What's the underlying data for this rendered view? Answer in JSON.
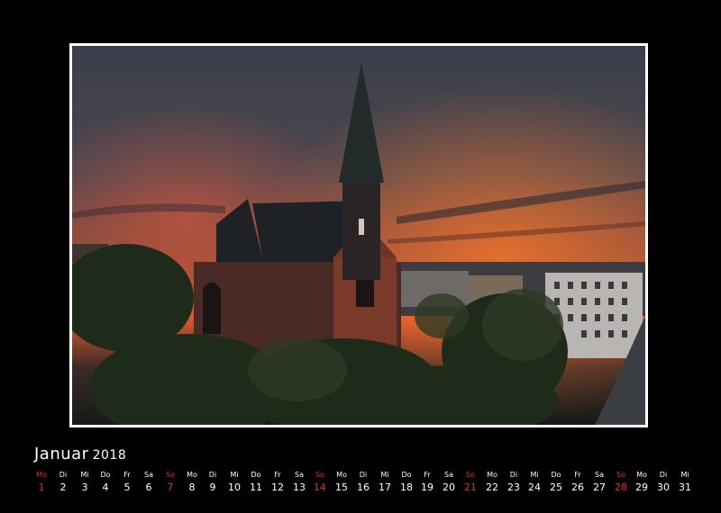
{
  "calendar": {
    "month": "Januar",
    "year": "2018",
    "sunday_color": "#e0302a",
    "days": [
      {
        "name": "Mo",
        "num": "1",
        "sunday": true
      },
      {
        "name": "Di",
        "num": "2",
        "sunday": false
      },
      {
        "name": "Mi",
        "num": "3",
        "sunday": false
      },
      {
        "name": "Do",
        "num": "4",
        "sunday": false
      },
      {
        "name": "Fr",
        "num": "5",
        "sunday": false
      },
      {
        "name": "Sa",
        "num": "6",
        "sunday": false
      },
      {
        "name": "So",
        "num": "7",
        "sunday": true
      },
      {
        "name": "Mo",
        "num": "8",
        "sunday": false
      },
      {
        "name": "Di",
        "num": "9",
        "sunday": false
      },
      {
        "name": "Mi",
        "num": "10",
        "sunday": false
      },
      {
        "name": "Do",
        "num": "11",
        "sunday": false
      },
      {
        "name": "Fr",
        "num": "12",
        "sunday": false
      },
      {
        "name": "Sa",
        "num": "13",
        "sunday": false
      },
      {
        "name": "So",
        "num": "14",
        "sunday": true
      },
      {
        "name": "Mo",
        "num": "15",
        "sunday": false
      },
      {
        "name": "Di",
        "num": "16",
        "sunday": false
      },
      {
        "name": "Mi",
        "num": "17",
        "sunday": false
      },
      {
        "name": "Do",
        "num": "18",
        "sunday": false
      },
      {
        "name": "Fr",
        "num": "19",
        "sunday": false
      },
      {
        "name": "Sa",
        "num": "20",
        "sunday": false
      },
      {
        "name": "So",
        "num": "21",
        "sunday": true
      },
      {
        "name": "Mo",
        "num": "22",
        "sunday": false
      },
      {
        "name": "Di",
        "num": "23",
        "sunday": false
      },
      {
        "name": "Mi",
        "num": "24",
        "sunday": false
      },
      {
        "name": "Do",
        "num": "25",
        "sunday": false
      },
      {
        "name": "Fr",
        "num": "26",
        "sunday": false
      },
      {
        "name": "Sa",
        "num": "27",
        "sunday": false
      },
      {
        "name": "So",
        "num": "28",
        "sunday": true
      },
      {
        "name": "Mo",
        "num": "29",
        "sunday": false
      },
      {
        "name": "Di",
        "num": "30",
        "sunday": false
      },
      {
        "name": "Mi",
        "num": "31",
        "sunday": false
      }
    ]
  }
}
